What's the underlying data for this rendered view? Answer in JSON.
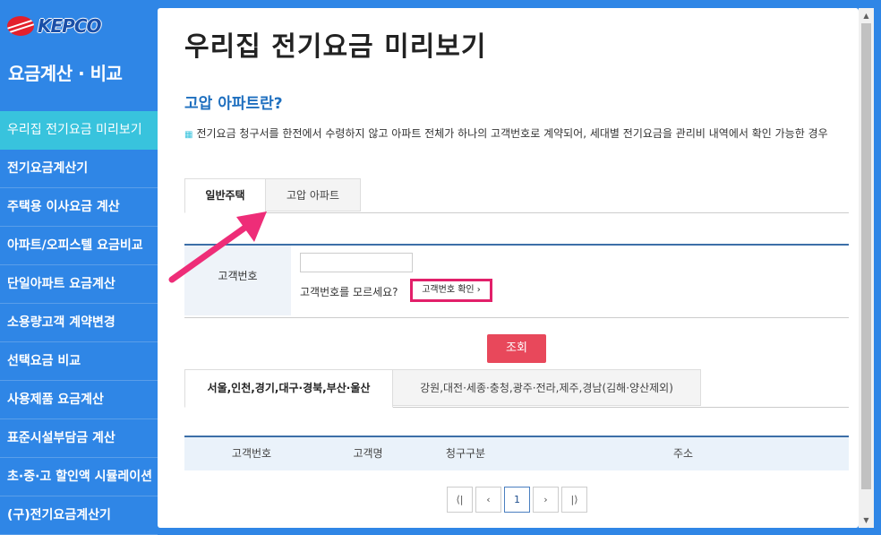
{
  "logo": {
    "text": "KEPCO"
  },
  "sidebar": {
    "title": "요금계산 · 비교",
    "items": [
      {
        "label": "우리집 전기요금 미리보기",
        "active": true
      },
      {
        "label": "전기요금계산기"
      },
      {
        "label": "주택용 이사요금 계산"
      },
      {
        "label": "아파트/오피스텔 요금비교"
      },
      {
        "label": "단일아파트 요금계산"
      },
      {
        "label": "소용량고객 계약변경"
      },
      {
        "label": "선택요금 비교"
      },
      {
        "label": "사용제품 요금계산"
      },
      {
        "label": "표준시설부담금 계산"
      },
      {
        "label": "초·중·고 할인액 시뮬레이션"
      },
      {
        "label": "(구)전기요금계산기"
      }
    ]
  },
  "main": {
    "title": "우리집 전기요금 미리보기",
    "section_title": "고압 아파트란?",
    "description": "전기요금 청구서를 한전에서 수령하지 않고 아파트 전체가 하나의 고객번호로 계약되어, 세대별 전기요금을 관리비 내역에서 확인 가능한 경우",
    "tabs": [
      {
        "label": "일반주택",
        "active": true
      },
      {
        "label": "고압 아파트"
      }
    ],
    "form": {
      "label": "고객번호",
      "input_value": "",
      "note": "고객번호를 모르세요?",
      "confirm_button": "고객번호 확인 ›"
    },
    "query_button": "조회",
    "region_tabs": [
      {
        "label": "서울,인천,경기,대구·경북,부산·울산",
        "active": true
      },
      {
        "label": "강원,대전·세종·충청,광주·전라,제주,경남(김해·양산제외)"
      }
    ],
    "table_headers": [
      "고객번호",
      "고객명",
      "청구구분",
      "주소"
    ],
    "pager": {
      "first": "⟨|",
      "prev": "‹",
      "current": "1",
      "next": "›",
      "last": "|⟩"
    }
  },
  "colors": {
    "sidebar": "#2f86e6",
    "active_menu": "#38c3dd",
    "query_button": "#e8485b",
    "highlight": "#e2206a"
  }
}
